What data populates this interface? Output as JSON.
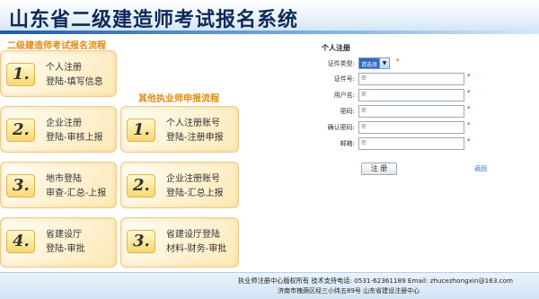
{
  "header": {
    "title": "山东省二级建造师考试报名系统"
  },
  "left": {
    "main_title": "二级建造师考试报名流程",
    "sub_title": "其他执业师申报流程",
    "steps_a": [
      {
        "num": "1.",
        "line1": "个人注册",
        "line2": "登陆-填写信息"
      },
      {
        "num": "2.",
        "line1": "企业注册",
        "line2": "登陆-审核上报"
      },
      {
        "num": "3.",
        "line1": "地市登陆",
        "line2": "审查-汇总-上报"
      },
      {
        "num": "4.",
        "line1": "省建设厅",
        "line2": "登陆-审批"
      }
    ],
    "steps_b": [
      {
        "num": "1.",
        "line1": "个人注册账号",
        "line2": "登陆-注册申报"
      },
      {
        "num": "2.",
        "line1": "企业注册账号",
        "line2": "登陆-汇总上报"
      },
      {
        "num": "3.",
        "line1": "省建设厅登陆",
        "line2": "材料-财务-审批"
      }
    ]
  },
  "form": {
    "title": "个人注册",
    "fields": [
      {
        "label": "证件类型:",
        "value": "请选择",
        "required": "*"
      },
      {
        "label": "证件号:",
        "placeholder": "密",
        "required": "*"
      },
      {
        "label": "用户名:",
        "placeholder": "密",
        "required": "*"
      },
      {
        "label": "密码:",
        "placeholder": "密",
        "required": "*"
      },
      {
        "label": "确认密码:",
        "placeholder": "密",
        "required": "*"
      },
      {
        "label": "邮箱:",
        "placeholder": "密",
        "required": "*"
      }
    ],
    "submit_label": "注 册",
    "back_label": "返回"
  },
  "footer": {
    "line1": "执业师注册中心版权所有  技术支持电话: 0531-62361189  Email: zhucezhongxin@163.com",
    "line2": "济南市槐荫区经三小纬五89号  山东省建设注册中心"
  },
  "colors": {
    "accent_orange": "#e08a12",
    "title_navy": "#0d2a57",
    "link_blue": "#2b5fb8",
    "required_red": "#d00000"
  }
}
